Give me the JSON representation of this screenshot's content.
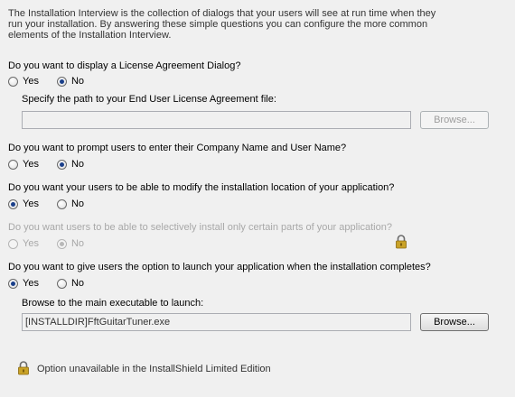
{
  "intro": "The Installation Interview is the collection of dialogs that your users will see at run time when they run your installation. By answering these simple questions you can configure the more common elements of the Installation Interview.",
  "questions": {
    "license": {
      "text": "Do you want to display a License Agreement Dialog?",
      "yes": "Yes",
      "no": "No",
      "path_label": "Specify the path to your End User License Agreement file:",
      "path_value": "",
      "browse": "Browse..."
    },
    "company": {
      "text": "Do you want to prompt users to enter their Company Name and User Name?",
      "yes": "Yes",
      "no": "No"
    },
    "location": {
      "text": "Do you want your users to be able to modify the installation location of your application?",
      "yes": "Yes",
      "no": "No"
    },
    "features": {
      "text": "Do you want users to be able to selectively install only certain parts of your application?",
      "yes": "Yes",
      "no": "No"
    },
    "launch": {
      "text": "Do you want to give users the option to launch your application when the installation completes?",
      "yes": "Yes",
      "no": "No",
      "exe_label": "Browse to the main executable to launch:",
      "exe_value": "[INSTALLDIR]FftGuitarTuner.exe",
      "browse": "Browse..."
    }
  },
  "footer": "Option unavailable in the InstallShield Limited Edition",
  "icons": {
    "lock": "lock-icon"
  },
  "colors": {
    "background": "#f0f0f0",
    "radio_checked": "#1a3f8a",
    "lock_body": "#c9a227"
  }
}
